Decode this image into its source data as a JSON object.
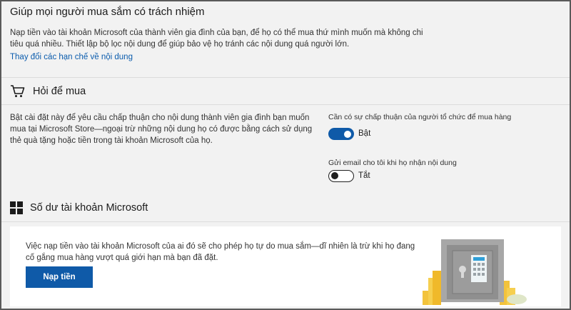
{
  "responsible": {
    "title": "Giúp mọi người mua sắm có trách nhiệm",
    "description": "Nạp tiền vào tài khoản Microsoft của thành viên gia đình của bạn, để họ có thể mua thứ mình muốn mà không chi tiêu quá nhiều. Thiết lập bộ lọc nội dung để giúp bảo vệ họ tránh các nội dung quá người lớn.",
    "link": "Thay đổi các hạn chế về nội dung"
  },
  "ask_to_buy": {
    "icon": "cart-icon",
    "title": "Hỏi để mua",
    "description": "Bật cài đặt này để yêu cầu chấp thuận cho nội dung thành viên gia đình bạn muốn mua tại Microsoft Store—ngoại trừ những nội dung họ có được bằng cách sử dụng thẻ quà tặng hoặc tiền trong tài khoản Microsoft của họ.",
    "approval_label": "Cần có sự chấp thuận của người tổ chức để mua hàng",
    "approval_state": "Bật",
    "approval_on": true,
    "email_label": "Gửi email cho tôi khi họ nhận nội dung",
    "email_state": "Tắt",
    "email_on": false
  },
  "balance": {
    "icon": "windows-logo-icon",
    "title": "Số dư tài khoản Microsoft",
    "description": "Việc nạp tiền vào tài khoản Microsoft của ai đó sẽ cho phép họ tự do mua sắm—dĩ nhiên là trừ khi họ đang cố gắng mua hàng vượt quá giới hạn mà bạn đã đặt.",
    "button_label": "Nạp tiền"
  },
  "colors": {
    "accent": "#0f5aa8",
    "link": "#0b5cad",
    "background": "#f2f2f2"
  }
}
